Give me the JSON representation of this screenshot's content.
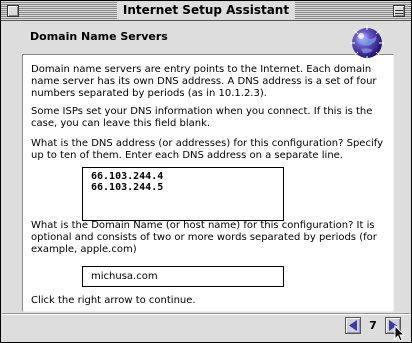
{
  "window": {
    "title": "Internet Setup Assistant"
  },
  "header": {
    "heading": "Domain Name Servers"
  },
  "content": {
    "para1": "Domain name servers are entry points to the Internet.  Each domain name server has its own DNS address. A DNS address is a set of four numbers separated by periods (as in 10.1.2.3).",
    "para2": "Some ISPs set your DNS information when you connect.  If this is the case, you can leave this field blank.",
    "para3": "What is the DNS address (or addresses) for this configuration?  Specify up to ten of them.  Enter each DNS address on a separate line.",
    "dns_addresses": [
      "66.103.244.4",
      "66.103.244.5"
    ],
    "para4": "What is the Domain Name (or host name) for this configuration?  It is optional and consists of two or more words separated by periods (for example, apple.com)",
    "domain_value": "michusa.com",
    "para5": "Click the right arrow to continue."
  },
  "footer": {
    "page_number": "7",
    "back_icon": "left-triangle-arrow",
    "forward_icon": "right-triangle-arrow"
  },
  "colors": {
    "window_bg": "#dddddd",
    "panel_bg": "#ffffff",
    "arrow_blue": "#3a3aa8"
  }
}
